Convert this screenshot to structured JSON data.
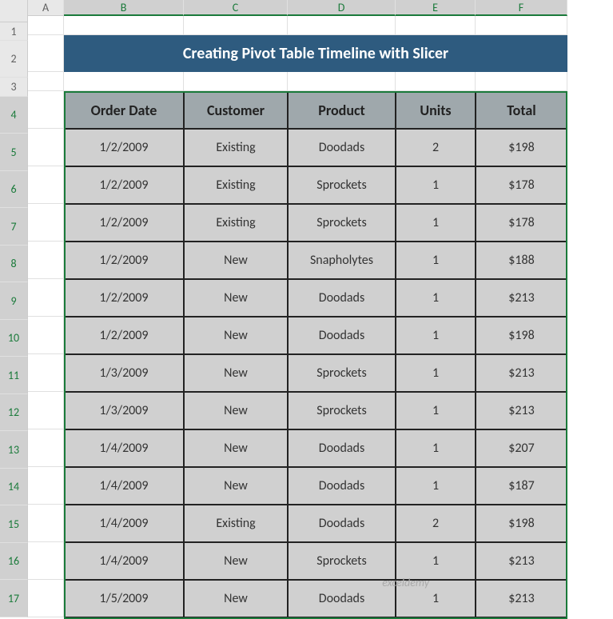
{
  "columns": [
    "A",
    "B",
    "C",
    "D",
    "E",
    "F"
  ],
  "rows": [
    "1",
    "2",
    "3",
    "4",
    "5",
    "6",
    "7",
    "8",
    "9",
    "10",
    "11",
    "12",
    "13",
    "14",
    "15",
    "16",
    "17"
  ],
  "title": "Creating Pivot Table Timeline with Slicer",
  "headers": {
    "order_date": "Order Date",
    "customer": "Customer",
    "product": "Product",
    "units": "Units",
    "total": "Total"
  },
  "data": [
    {
      "date": "1/2/2009",
      "customer": "Existing",
      "product": "Doodads",
      "units": "2",
      "total": "$198"
    },
    {
      "date": "1/2/2009",
      "customer": "Existing",
      "product": "Sprockets",
      "units": "1",
      "total": "$178"
    },
    {
      "date": "1/2/2009",
      "customer": "Existing",
      "product": "Sprockets",
      "units": "1",
      "total": "$178"
    },
    {
      "date": "1/2/2009",
      "customer": "New",
      "product": "Snapholytes",
      "units": "1",
      "total": "$188"
    },
    {
      "date": "1/2/2009",
      "customer": "New",
      "product": "Doodads",
      "units": "1",
      "total": "$213"
    },
    {
      "date": "1/2/2009",
      "customer": "New",
      "product": "Doodads",
      "units": "1",
      "total": "$198"
    },
    {
      "date": "1/3/2009",
      "customer": "New",
      "product": "Sprockets",
      "units": "1",
      "total": "$213"
    },
    {
      "date": "1/3/2009",
      "customer": "New",
      "product": "Sprockets",
      "units": "1",
      "total": "$213"
    },
    {
      "date": "1/4/2009",
      "customer": "New",
      "product": "Doodads",
      "units": "1",
      "total": "$207"
    },
    {
      "date": "1/4/2009",
      "customer": "New",
      "product": "Doodads",
      "units": "1",
      "total": "$187"
    },
    {
      "date": "1/4/2009",
      "customer": "Existing",
      "product": "Doodads",
      "units": "2",
      "total": "$198"
    },
    {
      "date": "1/4/2009",
      "customer": "New",
      "product": "Sprockets",
      "units": "1",
      "total": "$213"
    },
    {
      "date": "1/5/2009",
      "customer": "New",
      "product": "Doodads",
      "units": "1",
      "total": "$213"
    }
  ],
  "watermark": "exceldemy"
}
